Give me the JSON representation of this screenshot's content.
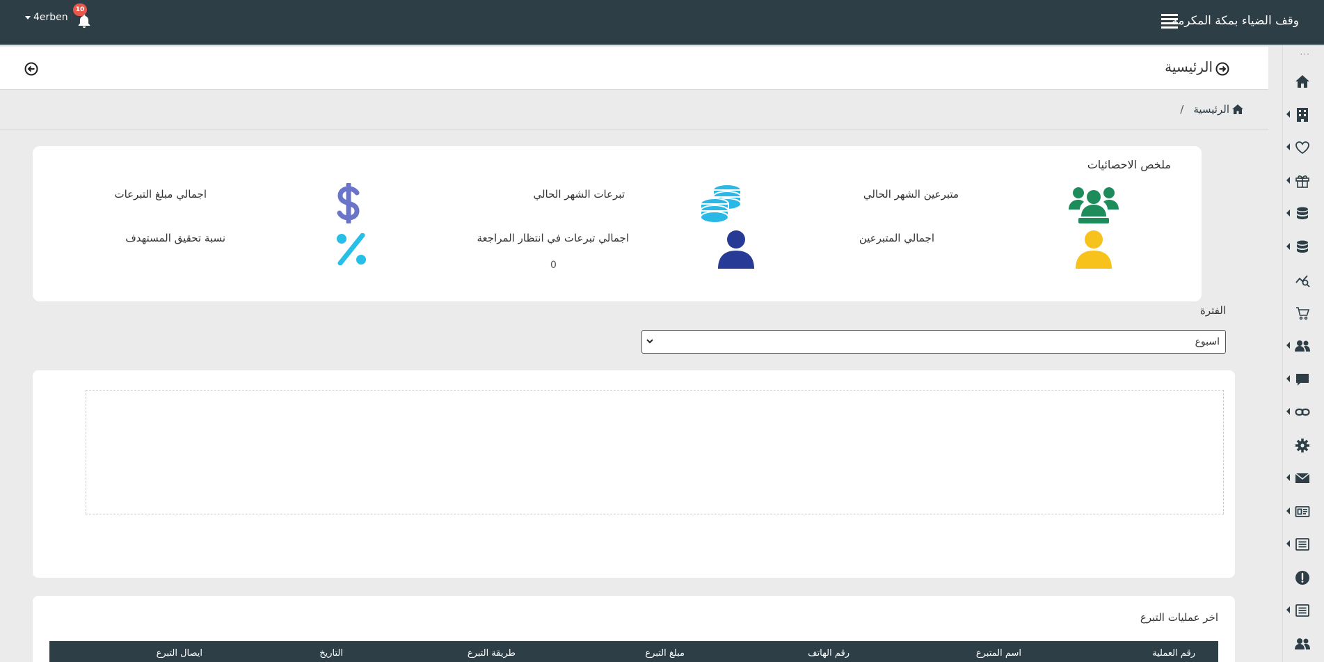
{
  "topbar": {
    "brand": "وقف الضياء بمكة المكرمة",
    "user": "4erben",
    "notifications_count": "10"
  },
  "page": {
    "title": "الرئيسية"
  },
  "breadcrumb": {
    "home": "الرئيسية",
    "separator": "/"
  },
  "stats": {
    "title": "ملخص الاحصائيات",
    "items": {
      "current_month_donors": {
        "label": "متبرعين الشهر الحالي"
      },
      "current_month_donations": {
        "label": "تبرعات الشهر الحالي"
      },
      "total_donations_amount": {
        "label": "اجمالي مبلغ التبرعات"
      },
      "total_donors": {
        "label": "اجمالي المتبرعين"
      },
      "pending_review_donations": {
        "label": "اجمالي تبرعات في انتظار المراجعة",
        "value": "0"
      },
      "target_achievement_ratio": {
        "label": "نسبة تحقيق المستهدف"
      }
    },
    "colors": {
      "green": "#1e8c5a",
      "cyan": "#2ab8e6",
      "indigo": "#6a74c9",
      "yellow": "#f7c21b",
      "navy": "#263a96",
      "sky": "#27bfe8"
    }
  },
  "filter": {
    "label": "الفترة",
    "selected": "اسبوع"
  },
  "latest_donations": {
    "title": "اخر عمليات التبرع",
    "columns": [
      "رقم العملية",
      "اسم المتبرع",
      "رقم الهاتف",
      "مبلغ التبرع",
      "طريقة التبرع",
      "التاريخ",
      "ايصال التبرع"
    ]
  },
  "sidebar": {
    "items": [
      {
        "icon": "home-icon",
        "has_submenu": false
      },
      {
        "icon": "building-icon",
        "has_submenu": true
      },
      {
        "icon": "heart-icon",
        "has_submenu": true
      },
      {
        "icon": "gift-icon",
        "has_submenu": true
      },
      {
        "icon": "database-icon",
        "has_submenu": true
      },
      {
        "icon": "database-icon",
        "has_submenu": true
      },
      {
        "icon": "chart-search-icon",
        "has_submenu": false
      },
      {
        "icon": "cart-icon",
        "has_submenu": false
      },
      {
        "icon": "users-icon",
        "has_submenu": true
      },
      {
        "icon": "comment-icon",
        "has_submenu": true
      },
      {
        "icon": "link-icon",
        "has_submenu": true
      },
      {
        "icon": "gear-icon",
        "has_submenu": false
      },
      {
        "icon": "envelope-icon",
        "has_submenu": true
      },
      {
        "icon": "id-card-icon",
        "has_submenu": true
      },
      {
        "icon": "list-icon",
        "has_submenu": true
      },
      {
        "icon": "alert-icon",
        "has_submenu": false
      },
      {
        "icon": "list-icon",
        "has_submenu": true
      },
      {
        "icon": "users-icon",
        "has_submenu": false
      }
    ]
  }
}
